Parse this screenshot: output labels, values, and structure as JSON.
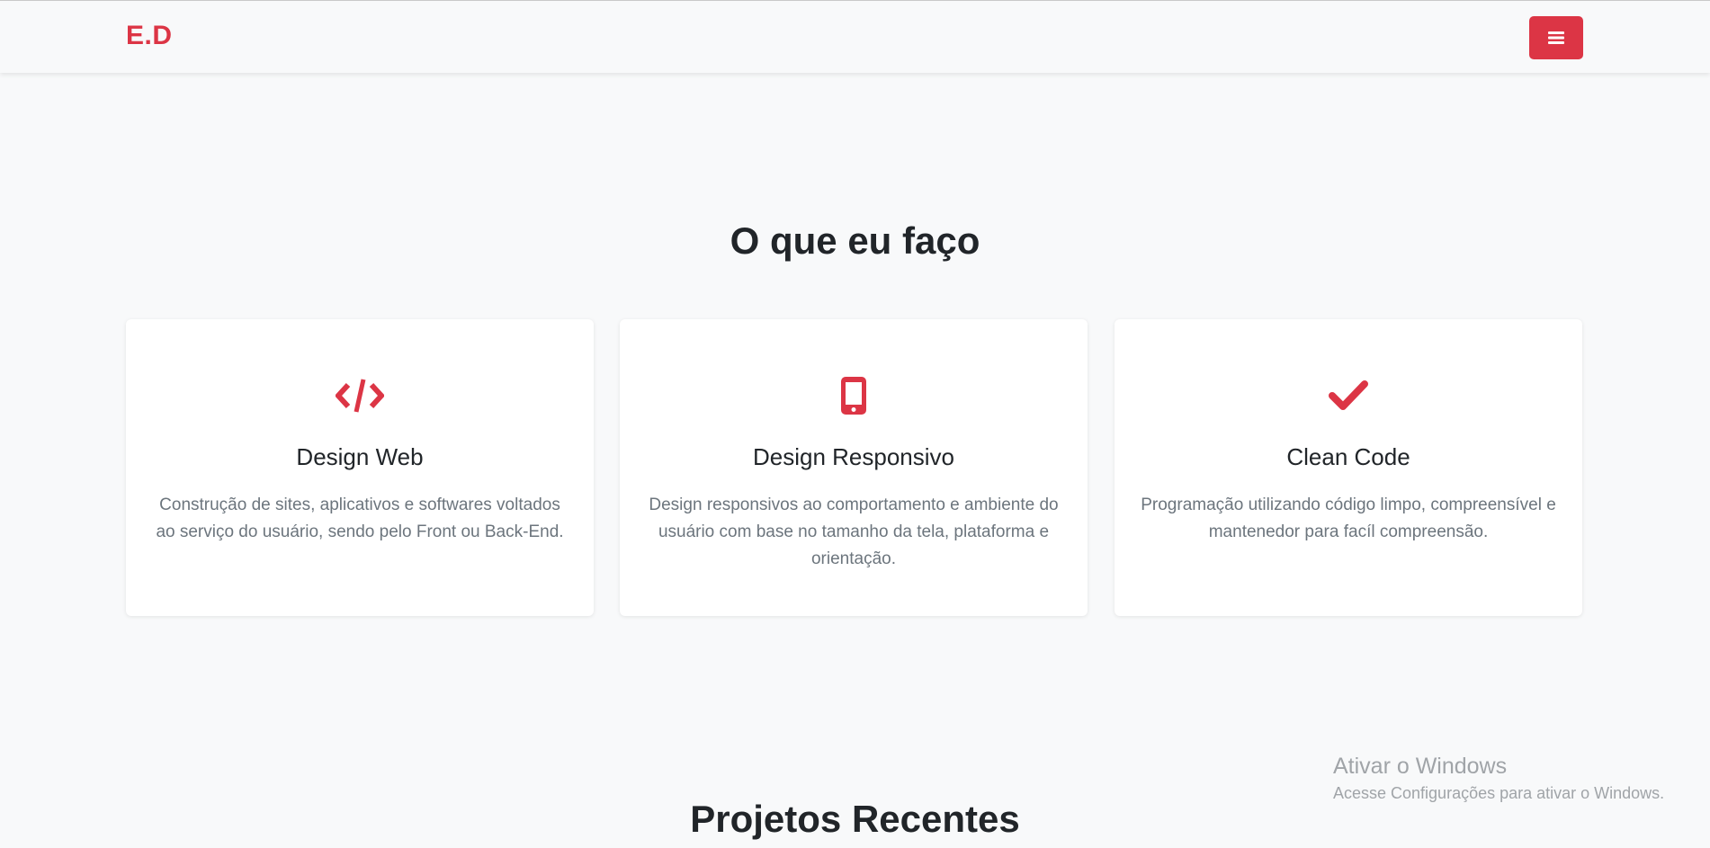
{
  "navbar": {
    "brand": "E.D",
    "menu_icon": "bars-icon"
  },
  "services": {
    "title": "O que eu faço",
    "cards": [
      {
        "icon": "code-icon",
        "heading": "Design Web",
        "text": "Construção de sites, aplicativos e softwares voltados ao serviço do usuário, sendo pelo Front ou Back-End."
      },
      {
        "icon": "mobile-icon",
        "heading": "Design Responsivo",
        "text": "Design responsivos ao comportamento e ambiente do usuário com base no tamanho da tela, plataforma e orientação."
      },
      {
        "icon": "check-icon",
        "heading": "Clean Code",
        "text": "Programação utilizando código limpo, compreensível e mantenedor para facíl compreensão."
      }
    ]
  },
  "projects": {
    "title": "Projetos Recentes"
  },
  "windows_activation": {
    "title": "Ativar o Windows",
    "subtitle": "Acesse Configurações para ativar o Windows."
  },
  "colors": {
    "accent": "#dc3545",
    "background": "#f8f9fa",
    "muted_text": "#6c757d"
  }
}
